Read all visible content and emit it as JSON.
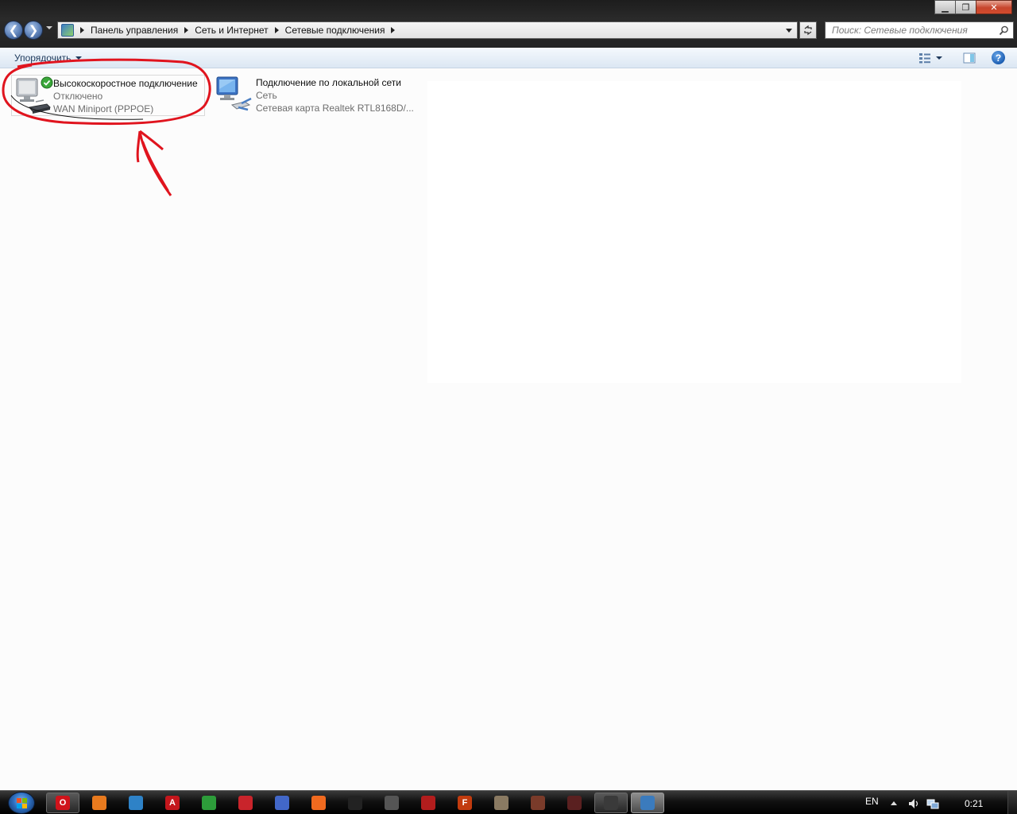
{
  "window": {
    "controls": {
      "minimize": "▁",
      "maximize": "❐",
      "close": "✕"
    }
  },
  "navigation": {
    "back_glyph": "❮",
    "forward_glyph": "❯"
  },
  "address_bar": {
    "breadcrumbs": [
      "Панель управления",
      "Сеть и Интернет",
      "Сетевые подключения"
    ]
  },
  "search": {
    "placeholder": "Поиск: Сетевые подключения"
  },
  "command_bar": {
    "organize_label": "Упорядочить",
    "help_glyph": "?"
  },
  "connections": [
    {
      "name": "Высокоскоростное подключение",
      "status": "Отключено",
      "device": "WAN Miniport (PPPOE)",
      "icon": "broadband-connection-icon",
      "selected": true
    },
    {
      "name": "Подключение по локальной сети",
      "status": "Сеть",
      "device": "Сетевая карта Realtek RTL8168D/...",
      "icon": "lan-connection-icon",
      "selected": false
    }
  ],
  "annotation": {
    "color": "#e0141e",
    "shape": "hand-drawn circle around first connection with upward arrow"
  },
  "taskbar": {
    "apps": [
      {
        "name": "opera",
        "glyph": "O",
        "color": "#d0131b"
      },
      {
        "name": "firefox",
        "glyph": "",
        "color": "#e87a1e"
      },
      {
        "name": "app-3",
        "glyph": "",
        "color": "#2e82c7"
      },
      {
        "name": "adobe-reader",
        "glyph": "A",
        "color": "#c4161c"
      },
      {
        "name": "app-5",
        "glyph": "",
        "color": "#2d9c3a"
      },
      {
        "name": "app-6",
        "glyph": "",
        "color": "#c9242b"
      },
      {
        "name": "app-7",
        "glyph": "",
        "color": "#4267c8"
      },
      {
        "name": "app-8",
        "glyph": "",
        "color": "#f06a1f"
      },
      {
        "name": "app-9",
        "glyph": "",
        "color": "#222222"
      },
      {
        "name": "steam",
        "glyph": "",
        "color": "#555555"
      },
      {
        "name": "app-11",
        "glyph": "",
        "color": "#b21d1d"
      },
      {
        "name": "app-12",
        "glyph": "F",
        "color": "#c23b0e"
      },
      {
        "name": "app-13",
        "glyph": "",
        "color": "#8a7a62"
      },
      {
        "name": "app-14",
        "glyph": "",
        "color": "#7a3b2a"
      },
      {
        "name": "app-15",
        "glyph": "",
        "color": "#5a2020"
      },
      {
        "name": "app-16",
        "glyph": "",
        "color": "#3a3a3a"
      },
      {
        "name": "explorer-network",
        "glyph": "",
        "color": "#3b7bbd"
      }
    ],
    "language": "EN",
    "clock": "0:21"
  }
}
